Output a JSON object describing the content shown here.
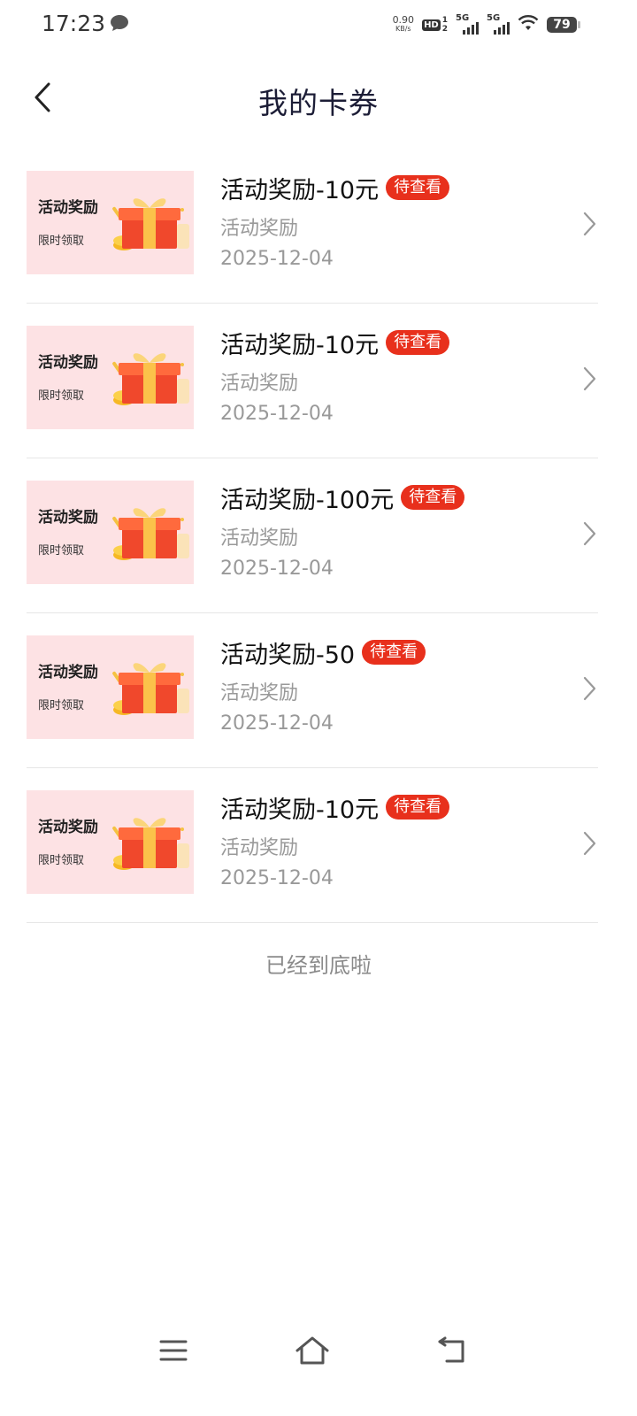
{
  "status_bar": {
    "time": "17:23",
    "net_speed_value": "0.90",
    "net_speed_unit": "KB/s",
    "hd_label": "HD",
    "hd_sim1": "1",
    "hd_sim2": "2",
    "sig1_label": "5G",
    "sig2_label": "5G",
    "battery": "79"
  },
  "header": {
    "title": "我的卡券",
    "back_icon": "chevron-left-icon"
  },
  "thumbnail": {
    "title": "活动奖励",
    "subtitle": "限时领取"
  },
  "coupons": [
    {
      "title": "活动奖励-10元",
      "badge": "待查看",
      "source": "活动奖励",
      "date": "2025-12-04"
    },
    {
      "title": "活动奖励-10元",
      "badge": "待查看",
      "source": "活动奖励",
      "date": "2025-12-04"
    },
    {
      "title": "活动奖励-100元",
      "badge": "待查看",
      "source": "活动奖励",
      "date": "2025-12-04"
    },
    {
      "title": "活动奖励-50",
      "badge": "待查看",
      "source": "活动奖励",
      "date": "2025-12-04"
    },
    {
      "title": "活动奖励-10元",
      "badge": "待查看",
      "source": "活动奖励",
      "date": "2025-12-04"
    }
  ],
  "end_text": "已经到底啦",
  "nav": {
    "menu_icon": "menu-icon",
    "home_icon": "home-icon",
    "back_icon": "back-icon"
  },
  "colors": {
    "badge": "#e8301c",
    "thumb_bg": "#fde2e4",
    "title_text": "#1c1d36",
    "muted_text": "#999999"
  }
}
